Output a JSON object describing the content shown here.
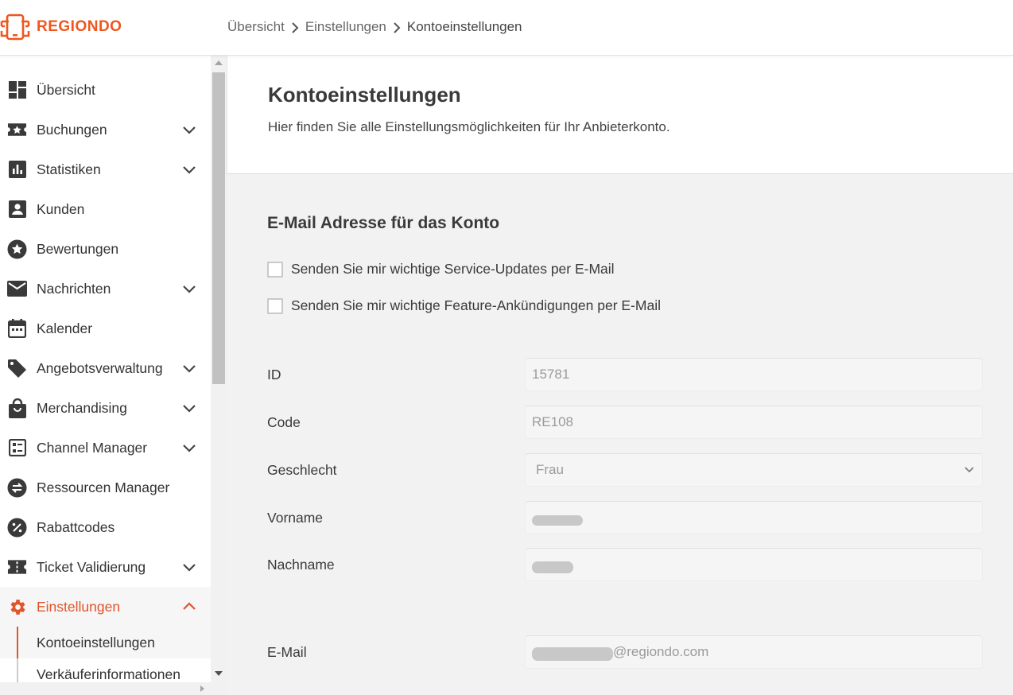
{
  "brand": {
    "name": "REGIONDO",
    "color": "#f0561d",
    "icon": "regiondo-logo-icon"
  },
  "breadcrumb": [
    {
      "label": "Übersicht"
    },
    {
      "label": "Einstellungen"
    },
    {
      "label": "Kontoeinstellungen"
    }
  ],
  "sidebar": {
    "items": [
      {
        "label": "Übersicht",
        "icon": "dashboard-icon",
        "expandable": false
      },
      {
        "label": "Buchungen",
        "icon": "booking-star-icon",
        "expandable": true
      },
      {
        "label": "Statistiken",
        "icon": "bar-chart-icon",
        "expandable": true
      },
      {
        "label": "Kunden",
        "icon": "customer-icon",
        "expandable": false
      },
      {
        "label": "Bewertungen",
        "icon": "star-circle-icon",
        "expandable": false
      },
      {
        "label": "Nachrichten",
        "icon": "mail-icon",
        "expandable": true
      },
      {
        "label": "Kalender",
        "icon": "calendar-icon",
        "expandable": false
      },
      {
        "label": "Angebotsverwaltung",
        "icon": "tag-icon",
        "expandable": true
      },
      {
        "label": "Merchandising",
        "icon": "shopping-bag-icon",
        "expandable": true
      },
      {
        "label": "Channel Manager",
        "icon": "channel-icon",
        "expandable": true
      },
      {
        "label": "Ressourcen Manager",
        "icon": "swap-icon",
        "expandable": false
      },
      {
        "label": "Rabattcodes",
        "icon": "percent-icon",
        "expandable": false
      },
      {
        "label": "Ticket Validierung",
        "icon": "ticket-icon",
        "expandable": true
      },
      {
        "label": "Einstellungen",
        "icon": "gear-icon",
        "expandable": true,
        "active": true
      }
    ],
    "subitems": [
      {
        "label": "Kontoeinstellungen",
        "active": true
      },
      {
        "label": "Verkäuferinformationen",
        "active": false
      }
    ],
    "active_color": "#e0552a"
  },
  "page": {
    "title": "Kontoeinstellungen",
    "subtitle": "Hier finden Sie alle Einstellungsmöglichkeiten für Ihr Anbieterkonto."
  },
  "email_section": {
    "title": "E-Mail Adresse für das Konto",
    "checkboxes": [
      {
        "label": "Senden Sie mir wichtige Service-Updates per E-Mail",
        "checked": false
      },
      {
        "label": "Senden Sie mir wichtige Feature-Ankündigungen per E-Mail",
        "checked": false
      }
    ]
  },
  "form": {
    "id": {
      "label": "ID",
      "value": "15781"
    },
    "code": {
      "label": "Code",
      "value": "RE108"
    },
    "gender": {
      "label": "Geschlecht",
      "value": "Frau"
    },
    "firstname": {
      "label": "Vorname"
    },
    "lastname": {
      "label": "Nachname"
    },
    "email": {
      "label": "E-Mail",
      "suffix": "@regiondo.com"
    }
  }
}
